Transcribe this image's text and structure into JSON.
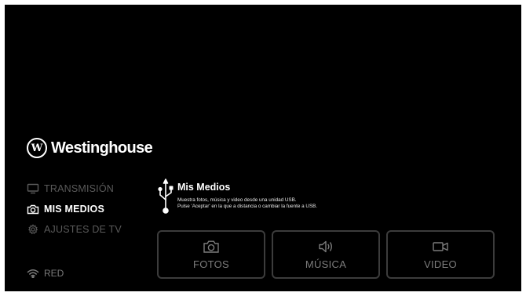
{
  "brand": {
    "logo_text": "W",
    "name": "Westinghouse"
  },
  "menu": {
    "items": [
      {
        "label": "TRANSMISIÓN",
        "icon": "monitor-icon",
        "active": false
      },
      {
        "label": "MIS MEDIOS",
        "icon": "camera-icon",
        "active": true
      },
      {
        "label": "AJUSTES DE TV",
        "icon": "gear-icon",
        "active": false
      }
    ],
    "network": {
      "label": "RED",
      "icon": "wifi-icon"
    }
  },
  "info": {
    "icon": "usb-icon",
    "title": "Mis Medios",
    "description_line1": "Muestra fotos, música y video desde una unidad USB.",
    "description_line2": "Pulse 'Aceptar' en la que a distancia o cambiar la fuente a USB."
  },
  "tiles": [
    {
      "label": "FOTOS",
      "icon": "camera-icon"
    },
    {
      "label": "MÚSICA",
      "icon": "speaker-icon"
    },
    {
      "label": "VIDEO",
      "icon": "video-camera-icon"
    }
  ],
  "colors": {
    "background": "#000000",
    "active_text": "#ffffff",
    "inactive_text": "#5a5a5a",
    "tile_border": "#3c3c3c",
    "tile_text": "#7c7c7c"
  }
}
